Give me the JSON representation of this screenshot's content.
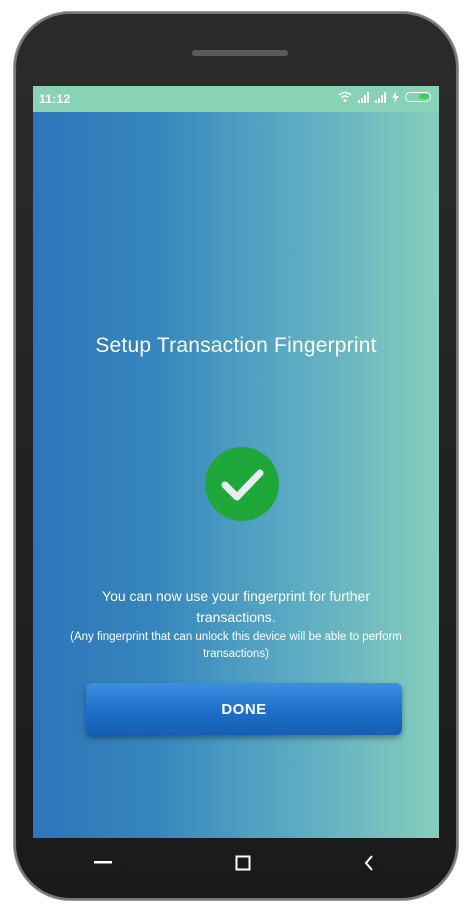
{
  "status_bar": {
    "time": "11:12",
    "icons": [
      "wifi-icon",
      "signal-icon",
      "signal-icon",
      "charging-icon",
      "battery-icon"
    ],
    "background": "#88d2b6",
    "battery_fill_color": "#3ad05a"
  },
  "screen": {
    "title": "Setup Transaction Fingerprint",
    "success_icon": "check-circle-icon",
    "success_color": "#1fa83a",
    "message": "You can now use your fingerprint for further transactions.",
    "note": "(Any fingerprint that can unlock this device will be able to perform transactions)",
    "done_label": "DONE",
    "done_color": "#1e6ec9",
    "gradient_colors": [
      "#2e74b9",
      "#86cdbd"
    ]
  },
  "navigation": {
    "buttons": [
      "menu-icon",
      "home-icon",
      "back-icon"
    ]
  }
}
